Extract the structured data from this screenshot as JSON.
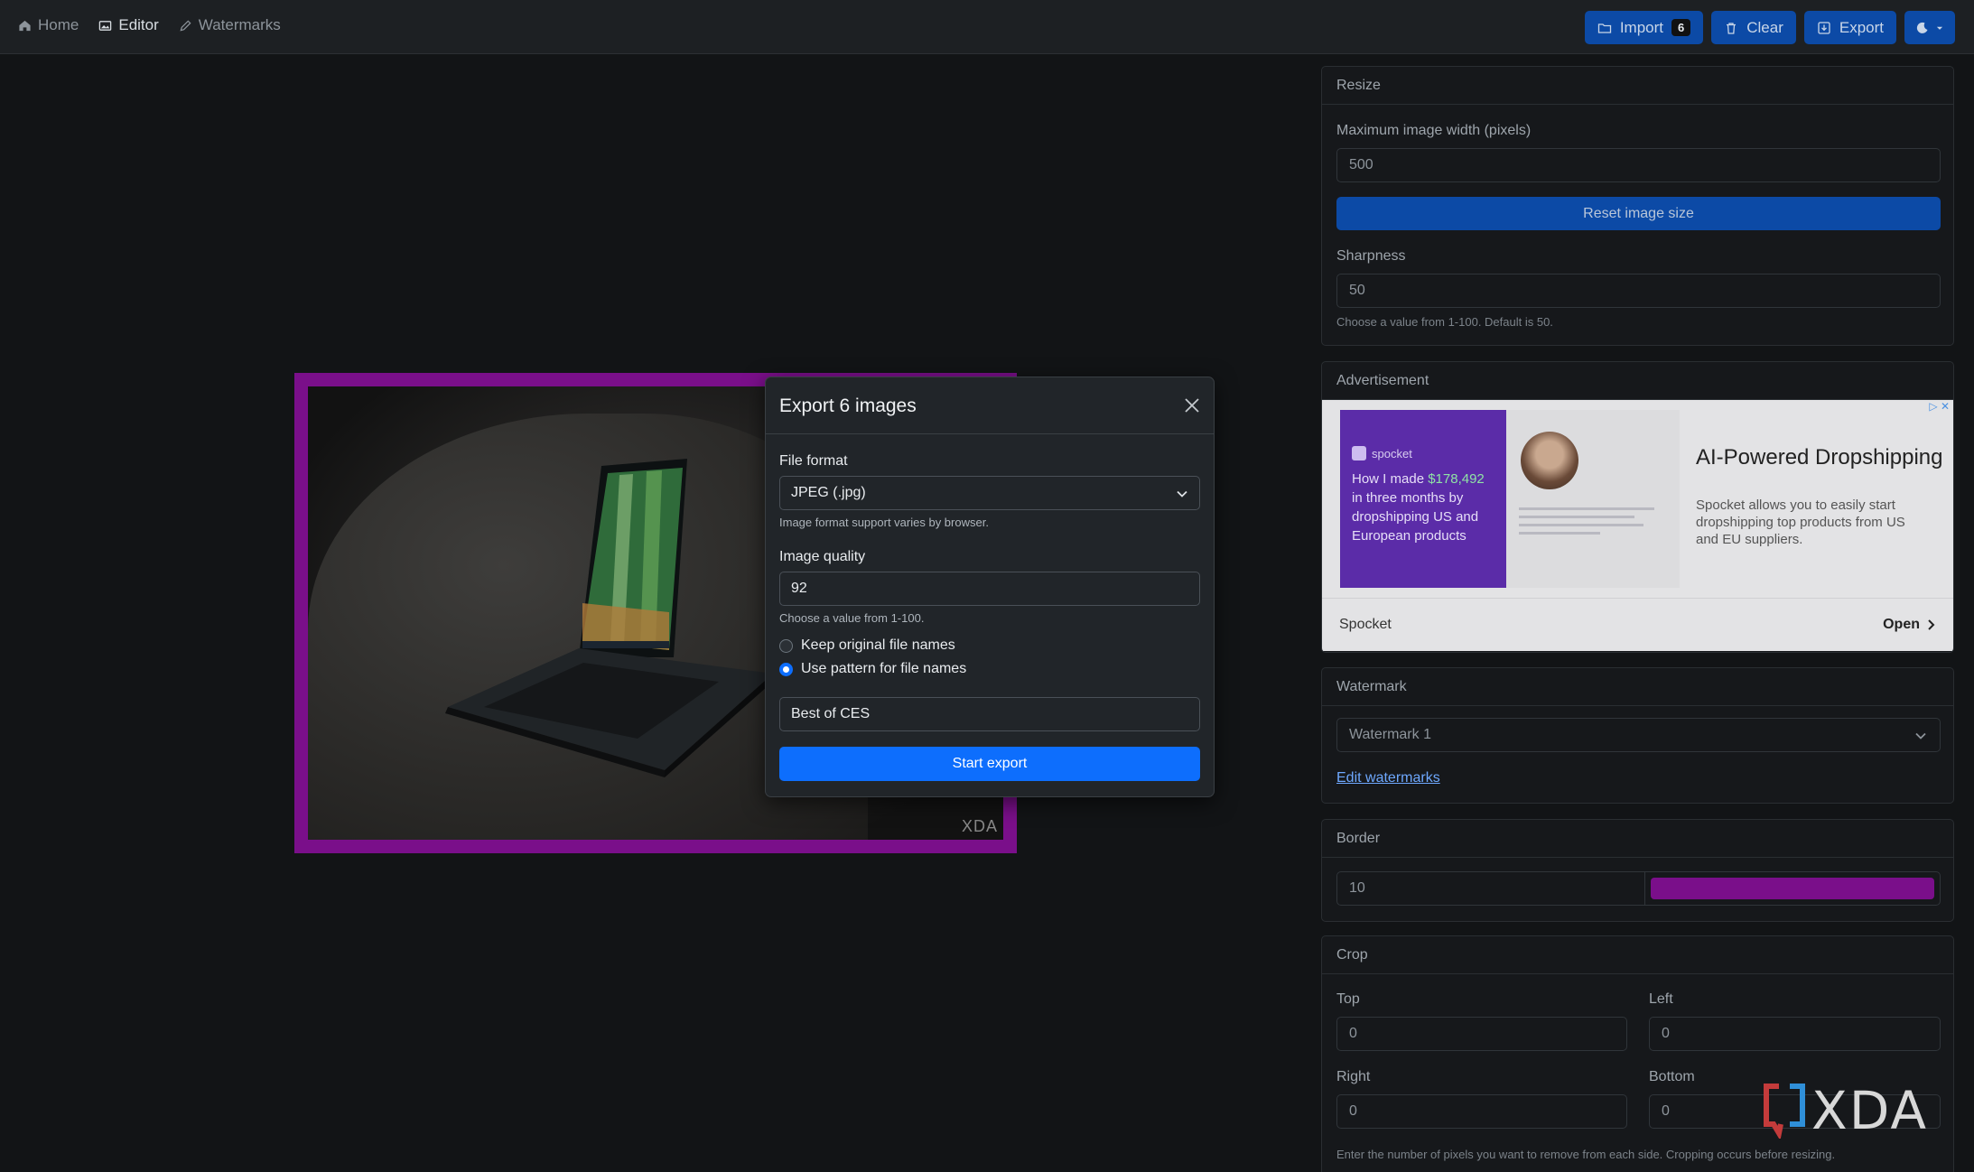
{
  "nav": {
    "links": [
      "Home",
      "Editor",
      "Watermarks"
    ],
    "import_label": "Import",
    "import_count": "6",
    "clear_label": "Clear",
    "export_label": "Export"
  },
  "preview": {
    "watermark_text": "XDA",
    "border_color": "#7a0f8a"
  },
  "modal": {
    "title": "Export 6 images",
    "file_format_label": "File format",
    "file_format_value": "JPEG (.jpg)",
    "file_format_help": "Image format support varies by browser.",
    "quality_label": "Image quality",
    "quality_value": "92",
    "quality_help": "Choose a value from 1-100.",
    "radio_keep": "Keep original file names",
    "radio_pattern": "Use pattern for file names",
    "pattern_value": "Best of CES",
    "start_label": "Start export"
  },
  "sidebar": {
    "resize": {
      "title": "Resize",
      "width_label": "Maximum image width (pixels)",
      "width_value": "500",
      "reset_label": "Reset image size",
      "sharpness_label": "Sharpness",
      "sharpness_value": "50",
      "sharpness_help": "Choose a value from 1-100. Default is 50."
    },
    "ad": {
      "title": "Advertisement",
      "brand": "spocket",
      "quote_pre": "How I made ",
      "quote_amount": "$178,492",
      "quote_post": " in three months by dropshipping US and European products",
      "headline": "AI-Powered Dropshipping",
      "description": "Spocket allows you to easily start dropshipping top products from US and EU suppliers.",
      "sponsor": "Spocket",
      "open_label": "Open"
    },
    "watermark": {
      "title": "Watermark",
      "selected": "Watermark 1",
      "edit_link": "Edit watermarks"
    },
    "border": {
      "title": "Border",
      "width_value": "10",
      "color": "#7a0f8a"
    },
    "crop": {
      "title": "Crop",
      "top_label": "Top",
      "top_value": "0",
      "left_label": "Left",
      "left_value": "0",
      "right_label": "Right",
      "right_value": "0",
      "bottom_label": "Bottom",
      "bottom_value": "0",
      "help": "Enter the number of pixels you want to remove from each side. Cropping occurs before resizing."
    }
  },
  "site_watermark": "XDA"
}
